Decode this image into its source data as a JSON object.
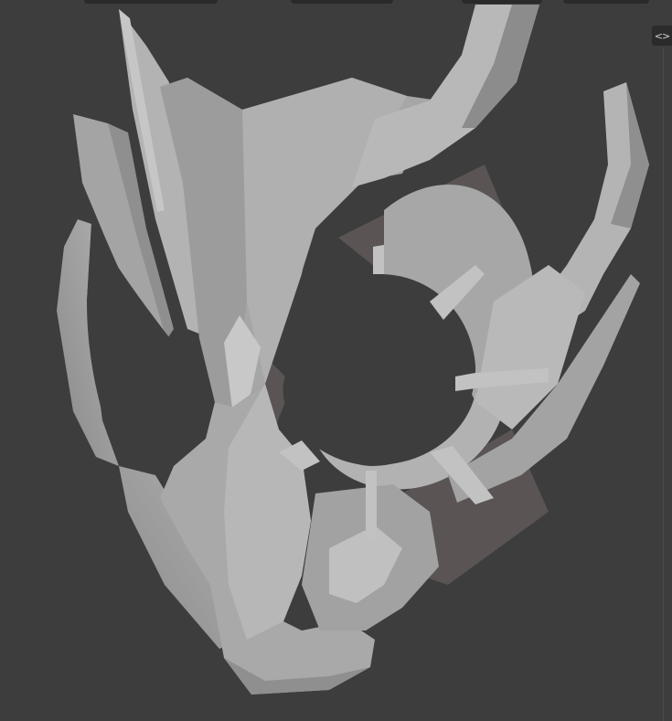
{
  "viewport": {
    "background_color": "#3d3d3d",
    "object_color": "#a9a9a9",
    "shadow_color": "#5a5454",
    "toggle": {
      "icon": "chevrons-left-right-icon",
      "label": "<>"
    }
  },
  "header": {
    "buttons": [
      "header-tool-button",
      "header-tool-button",
      "header-tool-button",
      "header-tool-button",
      "header-tool-button"
    ]
  }
}
